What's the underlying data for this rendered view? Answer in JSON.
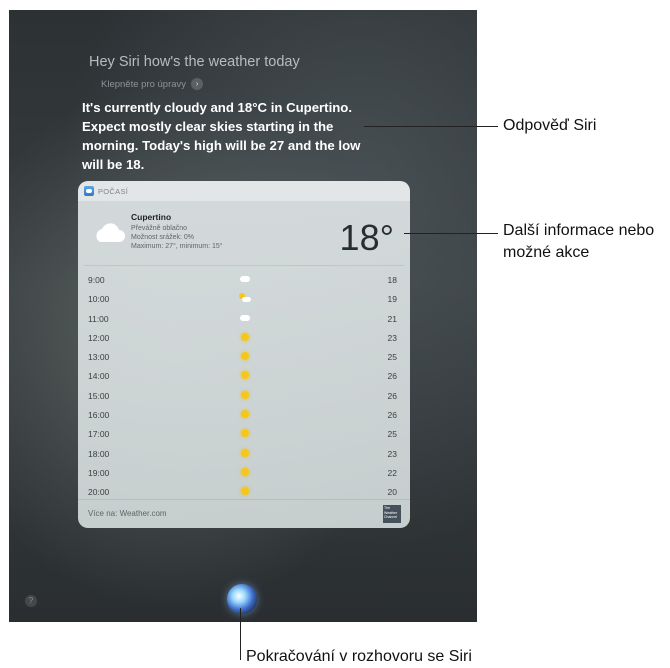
{
  "siri": {
    "query": "Hey Siri how's the weather today",
    "tap_to_edit": "Klepněte pro úpravy",
    "answer": "It's currently cloudy and 18°C in Cupertino. Expect mostly clear skies starting in the morning. Today's high will be 27 and the low will be 18."
  },
  "card": {
    "app_label": "POČASÍ",
    "city": "Cupertino",
    "condition": "Převážně oblačno",
    "precip": "Možnost srážek: 0%",
    "minmax": "Maximum: 27°, minimum: 15°",
    "temperature": "18°",
    "hourly": [
      {
        "time": "9:00",
        "icon": "cloud",
        "temp": "18"
      },
      {
        "time": "10:00",
        "icon": "partly-cloudy",
        "temp": "19"
      },
      {
        "time": "11:00",
        "icon": "cloud",
        "temp": "21"
      },
      {
        "time": "12:00",
        "icon": "sun",
        "temp": "23"
      },
      {
        "time": "13:00",
        "icon": "sun",
        "temp": "25"
      },
      {
        "time": "14:00",
        "icon": "sun",
        "temp": "26"
      },
      {
        "time": "15:00",
        "icon": "sun",
        "temp": "26"
      },
      {
        "time": "16:00",
        "icon": "sun",
        "temp": "26"
      },
      {
        "time": "17:00",
        "icon": "sun",
        "temp": "25"
      },
      {
        "time": "18:00",
        "icon": "sun",
        "temp": "23"
      },
      {
        "time": "19:00",
        "icon": "sun",
        "temp": "22"
      },
      {
        "time": "20:00",
        "icon": "sun",
        "temp": "20"
      }
    ],
    "more": "Více na: Weather.com",
    "twc_logo": "The Weather Channel"
  },
  "help_label": "?",
  "callouts": {
    "siri_answer": "Odpověď Siri",
    "more_info": "Další informace nebo možné akce",
    "continue": "Pokračování v rozhovoru se Siri"
  }
}
